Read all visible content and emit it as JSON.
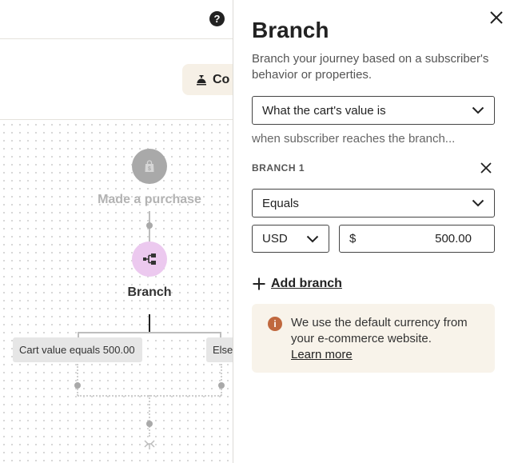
{
  "canvas": {
    "help_icon_glyph": "?",
    "continue_button_label": "Co",
    "trigger_node": {
      "label": "Made a purchase",
      "icon": "shopping-bag-icon",
      "color": "#a9a9a9"
    },
    "branch_node": {
      "label": "Branch",
      "icon": "branch-icon",
      "color": "#ecc9ef"
    },
    "branch_chips": [
      {
        "label": "Cart value equals 500.00"
      },
      {
        "label": "Else"
      }
    ]
  },
  "panel": {
    "title": "Branch",
    "description": "Branch your journey based on a subscriber's behavior or properties.",
    "property_select": {
      "value": "What the cart's value is"
    },
    "reach_text": "when subscriber reaches the branch...",
    "branch_heading": "BRANCH 1",
    "operator_select": {
      "value": "Equals"
    },
    "currency_select": {
      "value": "USD"
    },
    "value_field": {
      "prefix": "$",
      "value": "500.00"
    },
    "add_branch_label": "Add branch",
    "info": {
      "icon_glyph": "i",
      "text": "We use the default currency from your e-commerce website.",
      "link": "Learn more"
    }
  },
  "colors": {
    "accent_beige": "#f6f0e6",
    "info_icon": "#c0683e",
    "info_bg": "#f8f3ea"
  }
}
